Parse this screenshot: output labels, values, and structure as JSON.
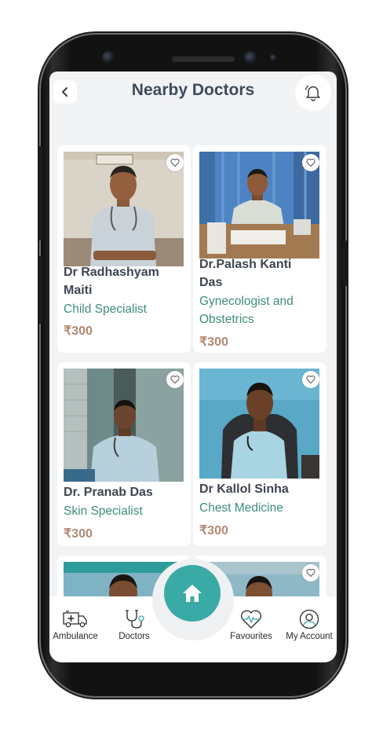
{
  "header": {
    "title": "Nearby Doctors",
    "back_icon": "chevron-left-icon",
    "notification_icon": "bell-icon"
  },
  "doctors": [
    {
      "name": "Dr Radhashyam Maiti",
      "specialty": "Child Specialist",
      "price": "₹300"
    },
    {
      "name": "Dr.Palash Kanti Das",
      "specialty": "Gynecologist and Obstetrics",
      "price": "₹300"
    },
    {
      "name": "Dr. Pranab Das",
      "specialty": "Skin Specialist",
      "price": "₹300"
    },
    {
      "name": "Dr Kallol Sinha",
      "specialty": "Chest Medicine",
      "price": "₹300"
    }
  ],
  "bottom_nav": {
    "items": [
      {
        "label": "Ambulance",
        "icon": "ambulance-icon"
      },
      {
        "label": "Doctors",
        "icon": "stethoscope-icon"
      },
      {
        "label": "Favourites",
        "icon": "heart-pulse-icon"
      },
      {
        "label": "My Account",
        "icon": "user-icon"
      }
    ],
    "home_icon": "home-icon"
  },
  "colors": {
    "accent": "#3aaaa7",
    "title": "#3e4b5c",
    "specialty": "#3d8d7d",
    "price": "#b38872",
    "background": "#f2f3f5"
  }
}
